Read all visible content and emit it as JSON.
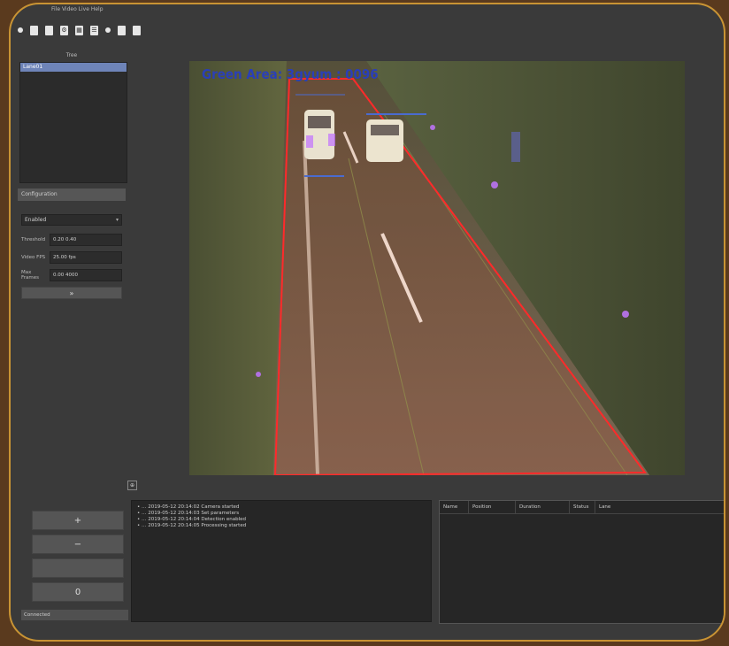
{
  "menubar": {
    "text": "File  Video  Live  Help"
  },
  "toolbar": {
    "buttons": [
      "open-icon",
      "save-icon",
      "copy-icon",
      "settings-icon",
      "grid-icon",
      "list-icon",
      "play-icon",
      "pause-icon",
      "export-icon"
    ]
  },
  "tree": {
    "title": "Tree",
    "items": [
      "Lane01"
    ]
  },
  "config": {
    "header": "Configuration",
    "mode_select": "Enabled",
    "fields": [
      {
        "label": "Threshold",
        "value": "0.20 0.40"
      },
      {
        "label": "Video FPS",
        "value": "25.00 fps"
      },
      {
        "label": "Max Frames",
        "value": "0.00 4000"
      }
    ],
    "apply_label": "»"
  },
  "bottom_buttons": [
    "+",
    "−",
    "",
    "0"
  ],
  "left_status": "Connected",
  "video": {
    "overlay_text": "Green Area: 3gyum : 0096"
  },
  "log": {
    "lines": [
      "•  … 2019-05-12 20:14:02  Camera started",
      "•  … 2019-05-12 20:14:03  Set parameters",
      "•  … 2019-05-12 20:14:04  Detection enabled",
      "•  … 2019-05-12 20:14:05  Processing started"
    ]
  },
  "table": {
    "headers": [
      "Name",
      "Position",
      "Duration",
      "Status",
      "Lane"
    ]
  },
  "colors": {
    "frame_border": "#c99434",
    "roi": "#ff2a2a",
    "overlay_text": "#2a3fb8",
    "selection": "#6e84b8"
  }
}
